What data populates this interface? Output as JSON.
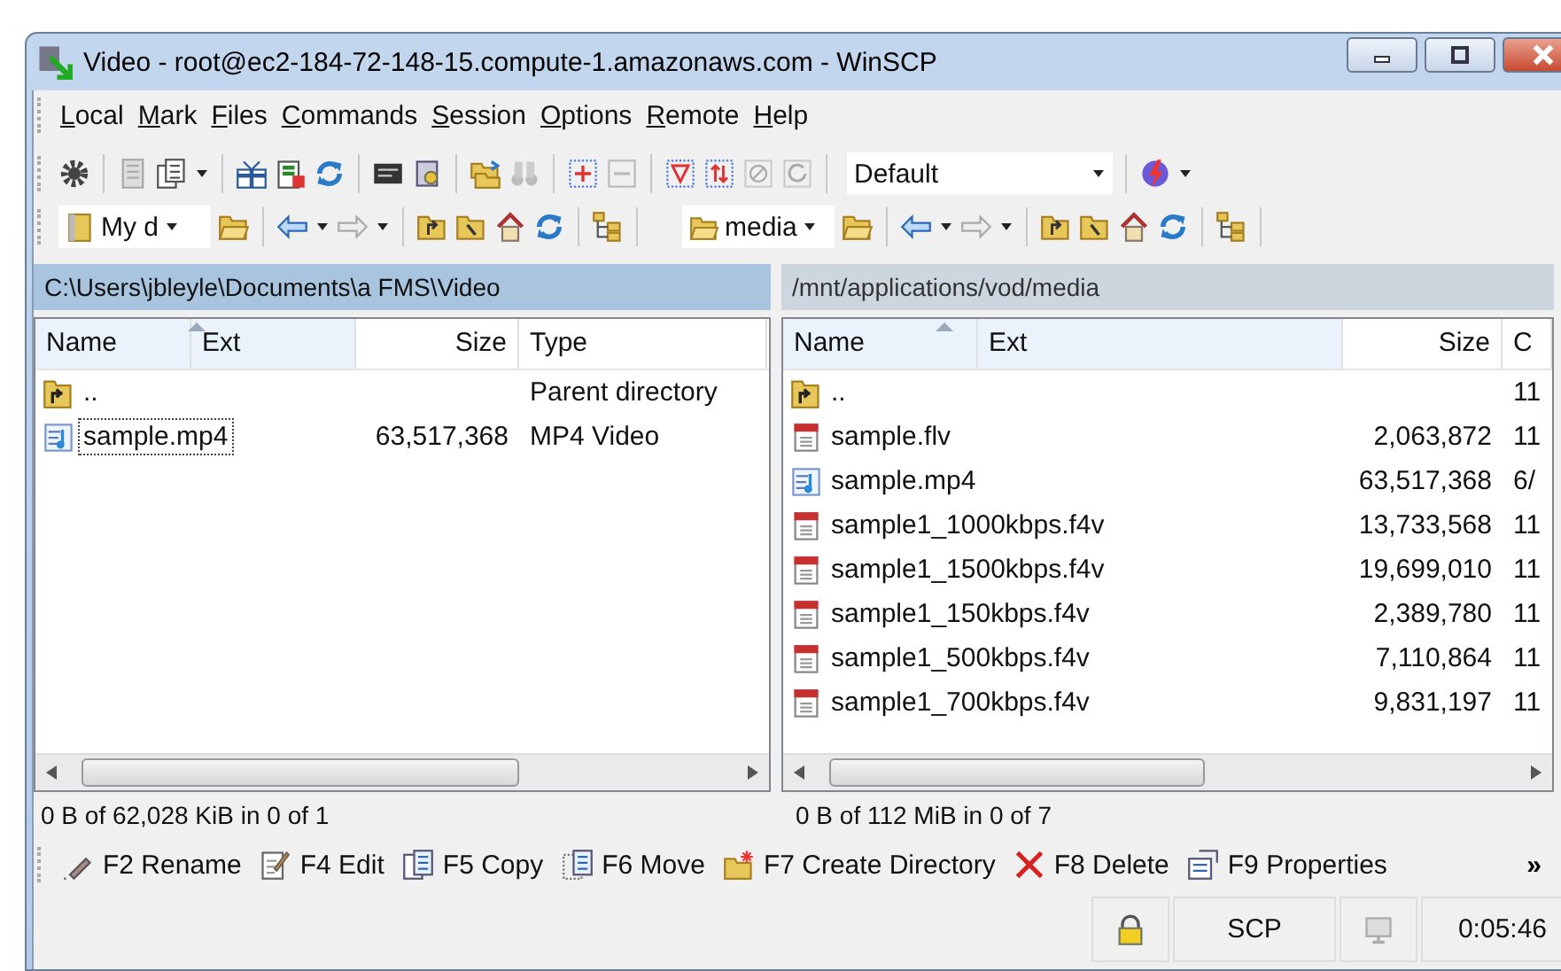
{
  "window": {
    "title": "Video - root@ec2-184-72-148-15.compute-1.amazonaws.com - WinSCP"
  },
  "menu": [
    {
      "label": "Local"
    },
    {
      "label": "Mark"
    },
    {
      "label": "Files"
    },
    {
      "label": "Commands"
    },
    {
      "label": "Session"
    },
    {
      "label": "Options"
    },
    {
      "label": "Remote"
    },
    {
      "label": "Help"
    }
  ],
  "toolbar": {
    "transfer_settings": "Default"
  },
  "left_panel": {
    "location": "My d",
    "path": "C:\\Users\\jbleyle\\Documents\\a FMS\\Video",
    "active": true,
    "columns": [
      {
        "kind": "name",
        "label": "Name",
        "sorted": true
      },
      {
        "kind": "ext",
        "label": "Ext",
        "sorted": true
      },
      {
        "kind": "size",
        "label": "Size",
        "sorted": false
      },
      {
        "kind": "type",
        "label": "Type",
        "sorted": false
      }
    ],
    "rows": [
      {
        "kind": "parent",
        "name": "..",
        "type": "Parent directory",
        "focused": false
      },
      {
        "kind": "video",
        "name": "sample.mp4",
        "size": "63,517,368",
        "type": "MP4 Video",
        "focused": true
      }
    ],
    "status": "0 B of 62,028 KiB in 0 of 1"
  },
  "right_panel": {
    "location": "media",
    "path": "/mnt/applications/vod/media",
    "active": false,
    "columns": [
      {
        "kind": "name",
        "label": "Name",
        "sorted": true
      },
      {
        "kind": "ext",
        "label": "Ext",
        "sorted": true
      },
      {
        "kind": "size",
        "label": "Size",
        "sorted": false
      },
      {
        "kind": "text",
        "label": "C",
        "sorted": false
      }
    ],
    "rows": [
      {
        "kind": "parent",
        "name": "..",
        "column_4": "11",
        "focused": false
      },
      {
        "kind": "file",
        "name": "sample.flv",
        "size": "2,063,872",
        "column_4": "11",
        "focused": false
      },
      {
        "kind": "video",
        "name": "sample.mp4",
        "size": "63,517,368",
        "column_4": "6/",
        "focused": false
      },
      {
        "kind": "file",
        "name": "sample1_1000kbps.f4v",
        "size": "13,733,568",
        "column_4": "11",
        "focused": false
      },
      {
        "kind": "file",
        "name": "sample1_1500kbps.f4v",
        "size": "19,699,010",
        "column_4": "11",
        "focused": false
      },
      {
        "kind": "file",
        "name": "sample1_150kbps.f4v",
        "size": "2,389,780",
        "column_4": "11",
        "focused": false
      },
      {
        "kind": "file",
        "name": "sample1_500kbps.f4v",
        "size": "7,110,864",
        "column_4": "11",
        "focused": false
      },
      {
        "kind": "file",
        "name": "sample1_700kbps.f4v",
        "size": "9,831,197",
        "column_4": "11",
        "focused": false
      }
    ],
    "status": "0 B of 112 MiB in 0 of 7"
  },
  "function_keys": [
    {
      "kind": "rename",
      "label": "F2 Rename"
    },
    {
      "kind": "edit",
      "label": "F4 Edit"
    },
    {
      "kind": "copy",
      "label": "F5 Copy"
    },
    {
      "kind": "move",
      "label": "F6 Move"
    },
    {
      "kind": "mkdir",
      "label": "F7 Create Directory"
    },
    {
      "kind": "delete",
      "label": "F8 Delete"
    },
    {
      "kind": "properties",
      "label": "F9 Properties"
    }
  ],
  "more_button": "»",
  "status_bar": {
    "protocol": "SCP",
    "elapsed": "0:05:46"
  }
}
